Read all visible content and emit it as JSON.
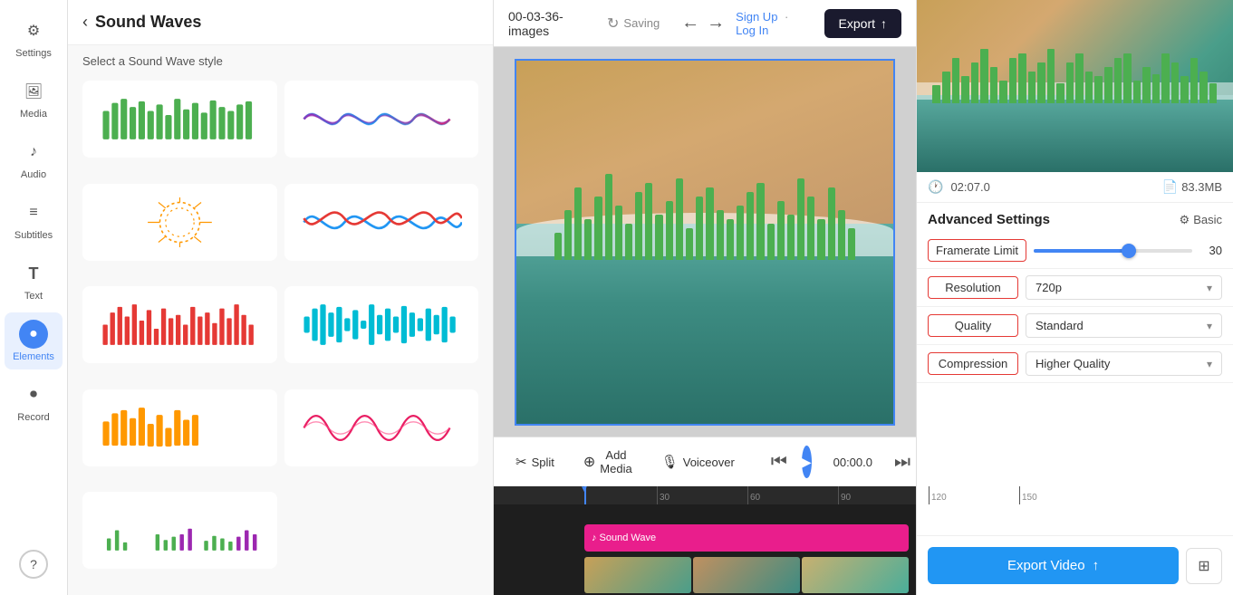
{
  "app": {
    "title": "Sound Waves"
  },
  "sidebar": {
    "items": [
      {
        "id": "settings",
        "label": "Settings",
        "icon": "⚙️",
        "active": false
      },
      {
        "id": "media",
        "label": "Media",
        "icon": "🖼️",
        "active": false
      },
      {
        "id": "audio",
        "label": "Audio",
        "icon": "🎵",
        "active": false
      },
      {
        "id": "subtitles",
        "label": "Subtitles",
        "icon": "💬",
        "active": false
      },
      {
        "id": "text",
        "label": "Text",
        "icon": "T",
        "active": false
      },
      {
        "id": "elements",
        "label": "Elements",
        "icon": "●",
        "active": true
      },
      {
        "id": "record",
        "label": "Record",
        "icon": "⏺",
        "active": false
      },
      {
        "id": "more",
        "label": "?",
        "icon": "?",
        "active": false
      }
    ]
  },
  "panel": {
    "back_label": "‹",
    "title": "Sound Waves",
    "subtitle": "Select a Sound Wave style"
  },
  "topbar": {
    "project_name": "00-03-36-images",
    "saving": "Saving",
    "sign_up": "Sign Up",
    "sign_in_sep": "·",
    "log_in": "Log In",
    "export_label": "Export",
    "undo": "←",
    "redo": "→"
  },
  "controls": {
    "split": "Split",
    "add_media": "Add Media",
    "voiceover": "Voiceover",
    "time": "00:00.0"
  },
  "timeline": {
    "track_label": "♪ Sound Wave",
    "marks": [
      {
        "pos": 100,
        "label": ""
      },
      {
        "pos": 200,
        "label": "30"
      },
      {
        "pos": 300,
        "label": "60"
      },
      {
        "pos": 400,
        "label": "90"
      },
      {
        "pos": 500,
        "label": "120"
      },
      {
        "pos": 600,
        "label": "150"
      }
    ]
  },
  "export_panel": {
    "duration": "02:07.0",
    "file_size": "83.3MB",
    "advanced_settings_title": "Advanced Settings",
    "basic_label": "Basic",
    "settings": [
      {
        "id": "framerate",
        "label": "Framerate Limit",
        "type": "slider",
        "value": 30,
        "slider_pct": 60
      },
      {
        "id": "resolution",
        "label": "Resolution",
        "type": "dropdown",
        "value": "720p"
      },
      {
        "id": "quality",
        "label": "Quality",
        "type": "dropdown",
        "value": "Standard"
      },
      {
        "id": "compression",
        "label": "Compression",
        "type": "dropdown",
        "value": "Higher Quality"
      }
    ],
    "export_video_label": "Export Video"
  },
  "wave_bars_heights": [
    30,
    55,
    80,
    45,
    70,
    95,
    60,
    40,
    75,
    85,
    50,
    65,
    90,
    35,
    70,
    80,
    55,
    45,
    60,
    75,
    85,
    40,
    65,
    50,
    90,
    70,
    45,
    80,
    55,
    35
  ],
  "preview_bar_heights": [
    20,
    35,
    50,
    30,
    45,
    60,
    40,
    25,
    50,
    55,
    35,
    45,
    60,
    22,
    45,
    55,
    35,
    30,
    40,
    50,
    55,
    25,
    40,
    32,
    55,
    45,
    30,
    50,
    35,
    22
  ]
}
